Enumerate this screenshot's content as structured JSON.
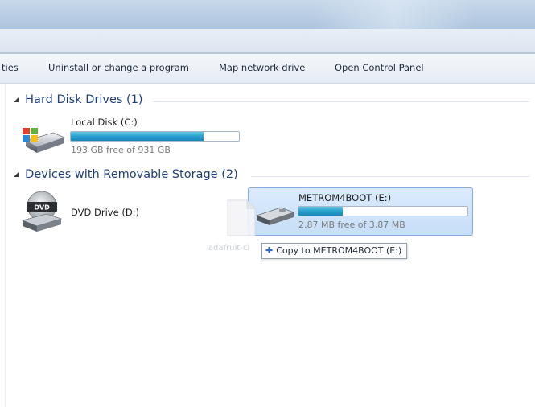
{
  "window": {
    "toolbar": {
      "items": [
        {
          "label": "ties"
        },
        {
          "label": "Uninstall or change a program"
        },
        {
          "label": "Map network drive"
        },
        {
          "label": "Open Control Panel"
        }
      ]
    }
  },
  "groups": {
    "hard_disk": {
      "header": "Hard Disk Drives (1)",
      "drives": [
        {
          "name": "Local Disk (C:)",
          "free_text": "193 GB free of 931 GB",
          "used_fraction": 0.79
        }
      ]
    },
    "removable": {
      "header": "Devices with Removable Storage (2)",
      "dvd": {
        "name": "DVD Drive (D:)",
        "icon_text": "DVD"
      },
      "usb": {
        "name": "METROM4BOOT (E:)",
        "free_text": "2.87 MB free of 3.87 MB",
        "used_fraction": 0.26
      }
    }
  },
  "drag": {
    "file_label": "adafruit-ci",
    "tooltip_icon": "plus-icon",
    "tooltip": "Copy to METROM4BOOT (E:)"
  },
  "colors": {
    "group_header": "#1e3f7a",
    "progress_fill": "#27a1cf",
    "selection": "#c6def8"
  }
}
